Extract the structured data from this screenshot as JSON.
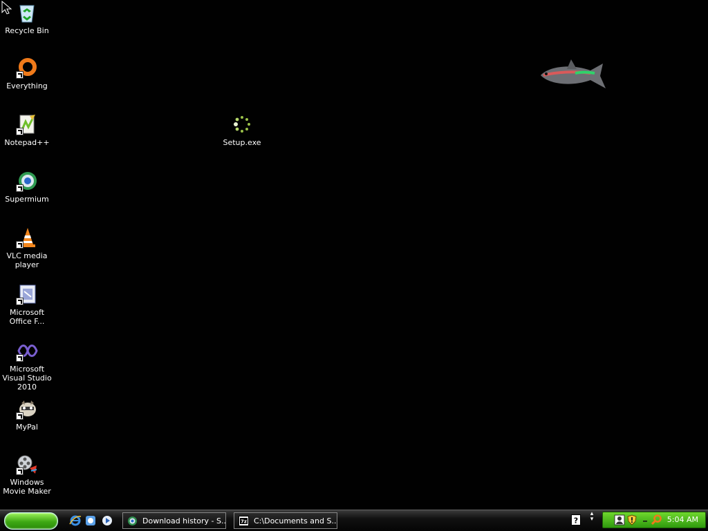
{
  "desktop": {
    "icons": [
      {
        "label": "Recycle Bin",
        "icon": "recycle-bin-icon"
      },
      {
        "label": "Everything",
        "icon": "everything-search-icon"
      },
      {
        "label": "Notepad++",
        "icon": "notepad-plus-plus-icon"
      },
      {
        "label": "Supermium",
        "icon": "supermium-browser-icon"
      },
      {
        "label": "VLC media player",
        "icon": "vlc-cone-icon"
      },
      {
        "label": "Microsoft Office F...",
        "icon": "office-file-icon"
      },
      {
        "label": "Microsoft Visual Studio 2010",
        "icon": "visual-studio-icon"
      },
      {
        "label": "MyPal",
        "icon": "mypal-browser-icon"
      },
      {
        "label": "Windows Movie Maker",
        "icon": "movie-maker-icon"
      },
      {
        "label": "Setup.exe",
        "icon": "loading-spinner-icon"
      }
    ],
    "wallpaper_fish": "neon-tetra-fish"
  },
  "taskbar": {
    "quick_launch": [
      "internet-explorer-icon",
      "browser-icon",
      "media-player-icon"
    ],
    "tasks": [
      {
        "label": "Download history - S...",
        "icon": "browser-icon"
      },
      {
        "label": "C:\\Documents and S...",
        "icon": "7zip-icon"
      }
    ],
    "tray": {
      "clock": "5:04 AM",
      "icons": [
        "help-icon",
        "user-icon",
        "shield-warning-icon",
        "search-icon"
      ]
    }
  },
  "colors": {
    "start": "#3ea814",
    "tray": "#4cb81e",
    "desktop": "#010101"
  }
}
